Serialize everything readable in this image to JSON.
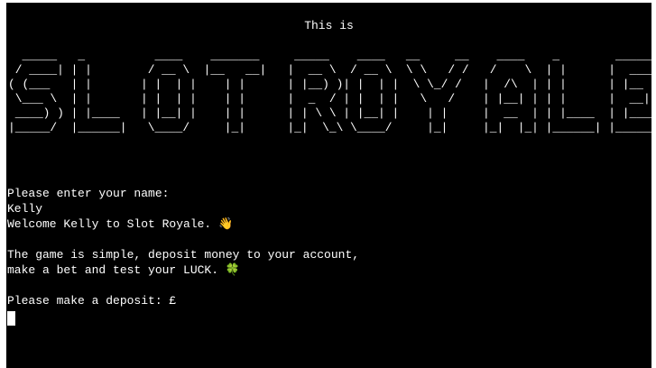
{
  "screen": {
    "background": "#000000",
    "foreground": "#ffffff"
  },
  "heading": "This is",
  "banner_art": "  _____   _          ____    _______     _____    ____   __     __    ____    _        ______ \n / ____| | |        / __ \\  |__   __|   |  __ \\  / __ \\  \\ \\   / /   /    \\  | |      |  ____|\n( (___   | |       | |  | |    | |      | |__) )| |  | |  \\ \\_/ /   |  /\\  | | |      | |__   \n \\___ \\  | |       | |  | |    | |      |  _  / | |  | |   \\   /    | |__| | | |      |  __|  \n ____) ) | |____   | |__| |    | |      | | \\ \\ | |__| |    | |     |  __  | | |____  | |____ \n|_____/  |______|   \\____/     |_|      |_|  \\_\\ \\____/     |_|     |_|  |_| |______| |______|",
  "output": {
    "name_prompt": "Please enter your name:",
    "name_value": "Kelly",
    "welcome": "Welcome Kelly to Slot Royale.",
    "welcome_icon": "waving-hand-icon",
    "welcome_emoji": "👋",
    "intro_line_1": "The game is simple, deposit money to your account,",
    "intro_line_2": "make a bet and test your LUCK.",
    "luck_icon": "four-leaf-clover-icon",
    "luck_emoji": "🍀",
    "deposit_prompt": "Please make a deposit: £",
    "deposit_value": ""
  }
}
